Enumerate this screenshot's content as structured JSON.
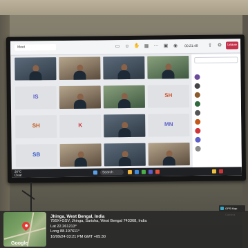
{
  "meeting": {
    "tab_label": "Meet",
    "timer": "00:21:48",
    "leave_label": "Leave",
    "tiles": [
      {
        "label": "",
        "type": "video",
        "tone": "cool"
      },
      {
        "label": "",
        "type": "video",
        "tone": "warm"
      },
      {
        "label": "",
        "type": "video",
        "tone": "cool"
      },
      {
        "label": "",
        "type": "video",
        "tone": "green"
      },
      {
        "label": "",
        "initials": "IS",
        "type": "initials",
        "color": "#5b5fc7"
      },
      {
        "label": "",
        "type": "video",
        "tone": "warm"
      },
      {
        "label": "",
        "type": "video",
        "tone": "green"
      },
      {
        "label": "",
        "initials": "SH",
        "type": "initials",
        "color": "#d1572f"
      },
      {
        "label": "",
        "initials": "SH",
        "type": "initials",
        "color": "#c2571a"
      },
      {
        "label": "",
        "initials": "K",
        "type": "initials",
        "color": "#d13438"
      },
      {
        "label": "",
        "type": "video",
        "tone": "cool"
      },
      {
        "label": "",
        "initials": "MN",
        "type": "initials",
        "color": "#5b5fc7"
      },
      {
        "label": "",
        "initials": "SB",
        "type": "initials",
        "color": "#3b5fc7"
      },
      {
        "label": "",
        "type": "video",
        "tone": "warm"
      },
      {
        "label": "",
        "type": "video",
        "tone": "cool"
      },
      {
        "label": "",
        "type": "video",
        "tone": "warm"
      }
    ]
  },
  "participants_panel": {
    "search_placeholder": "",
    "heading": "",
    "rows": [
      {
        "name": "",
        "color": "#6b4c9a"
      },
      {
        "name": "",
        "color": "#444444"
      },
      {
        "name": "",
        "color": "#8a5a2b"
      },
      {
        "name": "",
        "color": "#2f6a3e"
      },
      {
        "name": "",
        "color": "#555555"
      },
      {
        "name": "",
        "color": "#c2571a"
      },
      {
        "name": "",
        "color": "#d13438"
      },
      {
        "name": "",
        "color": "#5b5fc7"
      },
      {
        "name": "",
        "color": "#8a8a8a"
      }
    ]
  },
  "taskbar": {
    "weather": "26°C",
    "weather_sub": "Clear",
    "search_label": "Search"
  },
  "geotag": {
    "map_brand": "Google",
    "place": "Jhinga, West Bengal, India",
    "address": "756X+GSV, Jhinga, Sarisha, West Bengal 743368, India",
    "lat": "Lat 22.261213°",
    "long": "Long 88.197611°",
    "datetime": "16/09/24 03:21 PM GMT +05:30"
  },
  "watermark": {
    "label": "GPS Map Camera"
  }
}
